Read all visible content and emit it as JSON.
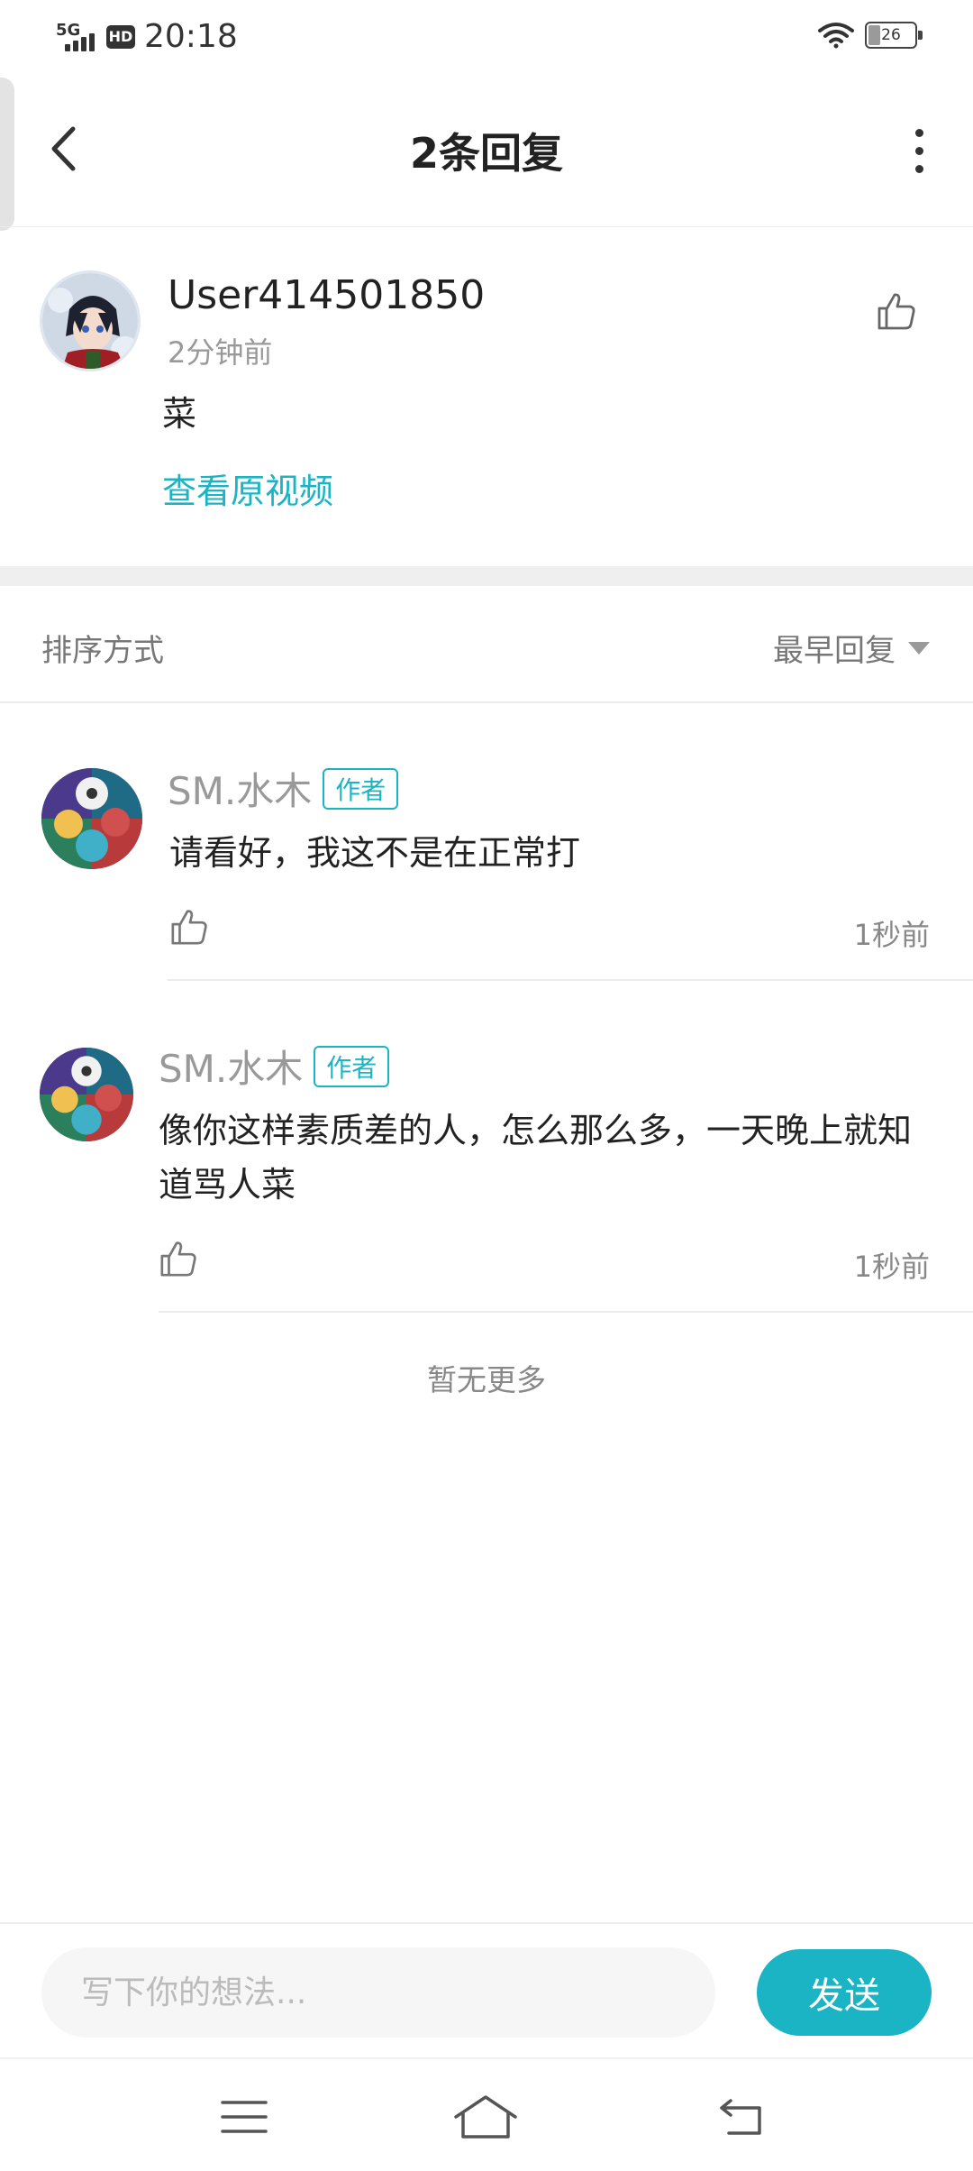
{
  "status_bar": {
    "network": "5G",
    "hd": "HD",
    "time": "20:18",
    "battery": "26"
  },
  "header": {
    "title": "2条回复",
    "back_icon": "chevron-left-icon",
    "more_icon": "more-vertical-icon"
  },
  "original_comment": {
    "username": "User414501850",
    "time_ago": "2分钟前",
    "content": "菜",
    "view_video_label": "查看原视频",
    "like_icon": "thumbs-up-icon"
  },
  "sort": {
    "label": "排序方式",
    "selected": "最早回复"
  },
  "replies": [
    {
      "username": "SM.水木",
      "badge": "作者",
      "content": "请看好，我这不是在正常打",
      "time": "1秒前"
    },
    {
      "username": "SM.水木",
      "badge": "作者",
      "content": "像你这样素质差的人，怎么那么多，一天晚上就知道骂人菜",
      "time": "1秒前"
    }
  ],
  "no_more_text": "暂无更多",
  "input_bar": {
    "placeholder": "写下你的想法...",
    "send_label": "发送"
  },
  "nav": {
    "menu_icon": "menu-icon",
    "home_icon": "home-icon",
    "back_icon": "return-icon"
  },
  "colors": {
    "accent": "#1ab4c4",
    "text_primary": "#222222",
    "text_secondary": "#999999"
  }
}
